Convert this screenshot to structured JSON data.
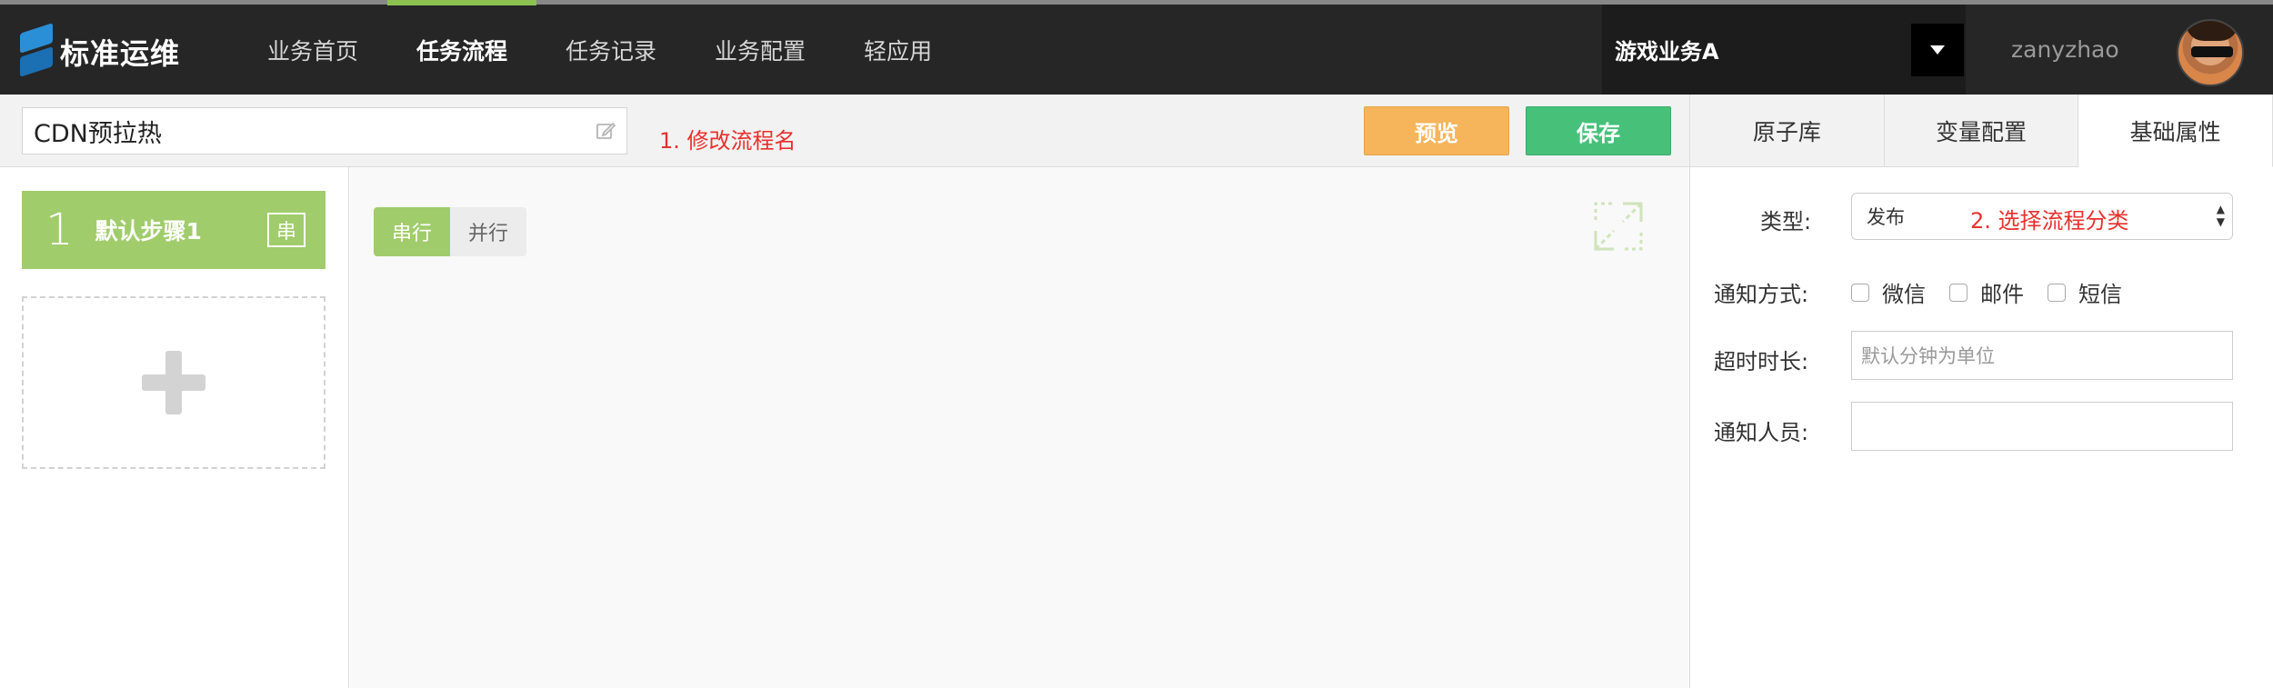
{
  "header": {
    "logo_text": "标准运维",
    "nav": [
      {
        "label": "业务首页",
        "active": false
      },
      {
        "label": "任务流程",
        "active": true
      },
      {
        "label": "任务记录",
        "active": false
      },
      {
        "label": "业务配置",
        "active": false
      },
      {
        "label": "轻应用",
        "active": false
      }
    ],
    "business": "游戏业务A",
    "username": "zanyzhao"
  },
  "toolbar": {
    "flow_name": "CDN预拉热",
    "hint_rename": "1. 修改流程名",
    "preview_label": "预览",
    "save_label": "保存"
  },
  "right_tabs": [
    {
      "label": "原子库",
      "active": false
    },
    {
      "label": "变量配置",
      "active": false
    },
    {
      "label": "基础属性",
      "active": true
    }
  ],
  "steps": [
    {
      "number": "1",
      "label": "默认步骤1",
      "tag": "串"
    }
  ],
  "canvas": {
    "mode_serial": "串行",
    "mode_parallel": "并行"
  },
  "properties": {
    "type_label": "类型:",
    "type_value": "发布",
    "hint_category": "2. 选择流程分类",
    "notify_label": "通知方式:",
    "notify_options": [
      "微信",
      "邮件",
      "短信"
    ],
    "timeout_label": "超时时长:",
    "timeout_placeholder": "默认分钟为单位",
    "receivers_label": "通知人员:",
    "receivers_value": ""
  },
  "colors": {
    "accent_green": "#8cc152",
    "step_green": "#a0cc6b",
    "preview_orange": "#f6b55a",
    "save_green": "#47c17a",
    "hint_red": "#e8312d"
  }
}
